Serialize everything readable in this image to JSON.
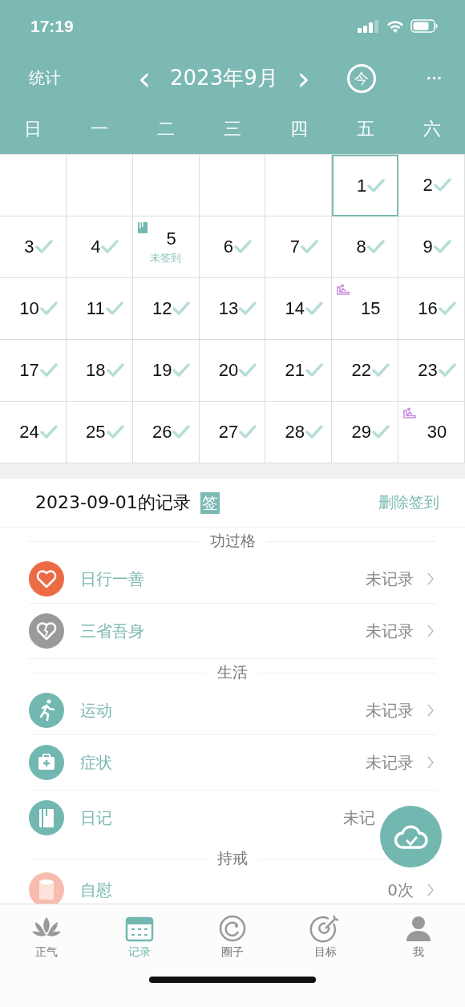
{
  "status_bar": {
    "time": "17:19"
  },
  "nav": {
    "left": "统计",
    "title": "2023年9月",
    "prev": "‹",
    "next": "›",
    "today": "今",
    "more": "···"
  },
  "weekdays": [
    "日",
    "一",
    "二",
    "三",
    "四",
    "五",
    "六"
  ],
  "calendar": {
    "days": [
      {
        "day": "1",
        "checked": true,
        "selected": true,
        "kind": "plain"
      },
      {
        "day": "2",
        "checked": true,
        "selected": false,
        "kind": "plain"
      },
      {
        "day": "3",
        "checked": true,
        "selected": false,
        "kind": "plain"
      },
      {
        "day": "4",
        "checked": true,
        "selected": false,
        "kind": "plain"
      },
      {
        "day": "5",
        "checked": false,
        "selected": false,
        "kind": "diary",
        "note": "未签到"
      },
      {
        "day": "6",
        "checked": true,
        "selected": false,
        "kind": "plain"
      },
      {
        "day": "7",
        "checked": true,
        "selected": false,
        "kind": "plain"
      },
      {
        "day": "8",
        "checked": true,
        "selected": false,
        "kind": "plain"
      },
      {
        "day": "9",
        "checked": true,
        "selected": false,
        "kind": "plain"
      },
      {
        "day": "10",
        "checked": true,
        "selected": false,
        "kind": "plain"
      },
      {
        "day": "11",
        "checked": true,
        "selected": false,
        "kind": "plain"
      },
      {
        "day": "12",
        "checked": true,
        "selected": false,
        "kind": "plain"
      },
      {
        "day": "13",
        "checked": true,
        "selected": false,
        "kind": "plain"
      },
      {
        "day": "14",
        "checked": true,
        "selected": false,
        "kind": "plain"
      },
      {
        "day": "15",
        "checked": false,
        "selected": false,
        "kind": "practice"
      },
      {
        "day": "16",
        "checked": true,
        "selected": false,
        "kind": "plain"
      },
      {
        "day": "17",
        "checked": true,
        "selected": false,
        "kind": "plain"
      },
      {
        "day": "18",
        "checked": true,
        "selected": false,
        "kind": "plain"
      },
      {
        "day": "19",
        "checked": true,
        "selected": false,
        "kind": "plain"
      },
      {
        "day": "20",
        "checked": true,
        "selected": false,
        "kind": "plain"
      },
      {
        "day": "21",
        "checked": true,
        "selected": false,
        "kind": "plain"
      },
      {
        "day": "22",
        "checked": true,
        "selected": false,
        "kind": "plain"
      },
      {
        "day": "23",
        "checked": true,
        "selected": false,
        "kind": "plain"
      },
      {
        "day": "24",
        "checked": true,
        "selected": false,
        "kind": "plain"
      },
      {
        "day": "25",
        "checked": true,
        "selected": false,
        "kind": "plain"
      },
      {
        "day": "26",
        "checked": true,
        "selected": false,
        "kind": "plain"
      },
      {
        "day": "27",
        "checked": true,
        "selected": false,
        "kind": "plain"
      },
      {
        "day": "28",
        "checked": true,
        "selected": false,
        "kind": "plain"
      },
      {
        "day": "29",
        "checked": true,
        "selected": false,
        "kind": "plain"
      },
      {
        "day": "30",
        "checked": false,
        "selected": false,
        "kind": "practice"
      }
    ]
  },
  "record": {
    "title": "2023-09-01的记录",
    "badge": "签",
    "action": "删除签到"
  },
  "sections": [
    {
      "title": "功过格",
      "items": [
        {
          "label": "日行一善",
          "value": "未记录",
          "chevron": true,
          "color": "#ec6b45"
        },
        {
          "label": "三省吾身",
          "value": "未记录",
          "chevron": true,
          "color": "#9a9a9a"
        }
      ]
    },
    {
      "title": "生活",
      "items": [
        {
          "label": "运动",
          "value": "未记录",
          "chevron": true,
          "color": "#72b8b0"
        },
        {
          "label": "症状",
          "value": "未记录",
          "chevron": true,
          "color": "#72b8b0"
        },
        {
          "label": "日记",
          "value": "未记",
          "chevron": false,
          "color": "#72b8b0"
        }
      ]
    },
    {
      "title": "持戒",
      "items": [
        {
          "label": "自慰",
          "value": "0次",
          "chevron": true,
          "color": "#f8bcae"
        }
      ]
    }
  ],
  "tabs": [
    {
      "label": "正气",
      "selected": false
    },
    {
      "label": "记录",
      "selected": true
    },
    {
      "label": "圈子",
      "selected": false
    },
    {
      "label": "目标",
      "selected": false
    },
    {
      "label": "我",
      "selected": false
    }
  ]
}
